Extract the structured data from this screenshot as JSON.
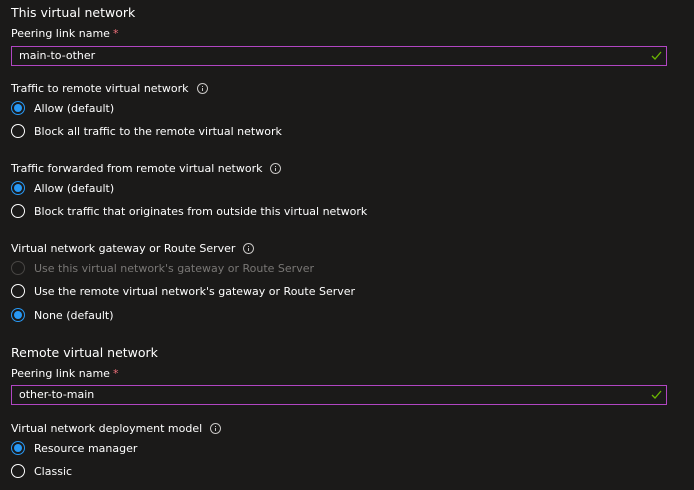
{
  "this_network": {
    "section_title": "This virtual network",
    "peering_label": "Peering link name",
    "required_mark": "*",
    "peering_value": "main-to-other",
    "traffic_to_remote": {
      "label": "Traffic to remote virtual network",
      "options": [
        "Allow (default)",
        "Block all traffic to the remote virtual network"
      ],
      "selected": "Allow (default)"
    },
    "traffic_forwarded": {
      "label": "Traffic forwarded from remote virtual network",
      "options": [
        "Allow (default)",
        "Block traffic that originates from outside this virtual network"
      ],
      "selected": "Allow (default)"
    },
    "gateway": {
      "label": "Virtual network gateway or Route Server",
      "options": [
        "Use this virtual network's gateway or Route Server",
        "Use the remote virtual network's gateway or Route Server",
        "None (default)"
      ],
      "selected": "None (default)",
      "disabled": "Use this virtual network's gateway or Route Server"
    }
  },
  "remote_network": {
    "section_title": "Remote virtual network",
    "peering_label": "Peering link name",
    "required_mark": "*",
    "peering_value": "other-to-main",
    "deployment_model": {
      "label": "Virtual network deployment model",
      "options": [
        "Resource manager",
        "Classic"
      ],
      "selected": "Resource manager"
    }
  },
  "colors": {
    "background": "#1b1a19",
    "input_border": "#b146c2",
    "radio_selected": "#2899f5",
    "required": "#f1707b",
    "check": "#6bb700"
  }
}
